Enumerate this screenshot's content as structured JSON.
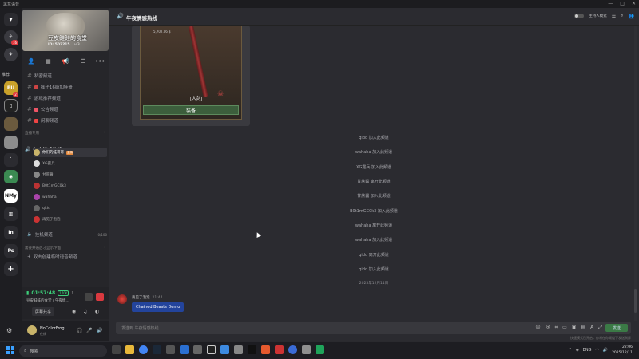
{
  "window": {
    "title": "黑盒语音"
  },
  "rail": {
    "label_home": "推荐",
    "badges": {
      "a": "16",
      "b": "2"
    },
    "servers": [
      "PUBG",
      "HT",
      "n",
      "",
      "",
      "NMy",
      "",
      "In",
      "Ps"
    ]
  },
  "server": {
    "name": "豆皮鲑鲑的食堂",
    "id_label": "ID: 502215",
    "level": "Lv.3"
  },
  "channels": {
    "text": [
      {
        "label": "私密频道"
      },
      {
        "label": "摔子16级加鲑哥"
      },
      {
        "label": "游戏推荐频道"
      },
      {
        "label": "公告频道"
      },
      {
        "label": "闲聊频道"
      }
    ],
    "voice_category": "直播专用",
    "active_voice": "午夜情感热线",
    "members": [
      {
        "name": "你们的鲑哥哥",
        "tag": "主持"
      },
      {
        "name": "XG露兵"
      },
      {
        "name": "甘蔗醤"
      },
      {
        "name": "B0t1mGC0k3"
      },
      {
        "name": "wahaha"
      },
      {
        "name": "qidd"
      },
      {
        "name": "再见了泡泡"
      }
    ],
    "afk": {
      "label": "挂机频道",
      "count": "0/100"
    },
    "temp_category": "需要开通后才显示下面",
    "temp_create": "双击创建临时语音频道"
  },
  "voice_status": {
    "time": "01:57:48",
    "ping": "170K",
    "count": "1",
    "location": "豆皮鲑鲑的食堂 / 午夜情...",
    "share_label": "屏幕共享"
  },
  "user": {
    "name": "NoColorFrog",
    "status": "在线"
  },
  "header": {
    "channel": "午夜情感热线",
    "host_mode": "主持人模式"
  },
  "card": {
    "price": "5,702.06 $",
    "item_name": "[大剑]",
    "equip_label": "装备"
  },
  "system_messages": [
    "qidd 加入此频道",
    "wahaha 加入此频道",
    "XG露兵 加入此频道",
    "甘蔗醤 离开此频道",
    "甘蔗醤 加入此频道",
    "B0t1mGC0k3 加入此频道",
    "wahaha 离开此频道",
    "wahaha 加入此频道",
    "qidd 离开此频道",
    "qidd 加入此频道"
  ],
  "date_separator": "2025年12月11日",
  "message": {
    "author": "再见了泡泡",
    "time": "21:44",
    "button_label": "Chained Beasts Demo"
  },
  "input": {
    "placeholder": "发送到 午夜情感热线",
    "send_label": "发送",
    "hint": "快速模式已开启，你将在你频道下发送刷屏"
  },
  "taskbar": {
    "search_placeholder": "搜索",
    "lang": "ENG",
    "time": "22:06",
    "date": "2025/12/11"
  },
  "colors": {
    "accent_green": "#3dd07a",
    "link_blue": "#23449c",
    "badge_red": "#e0383e"
  }
}
